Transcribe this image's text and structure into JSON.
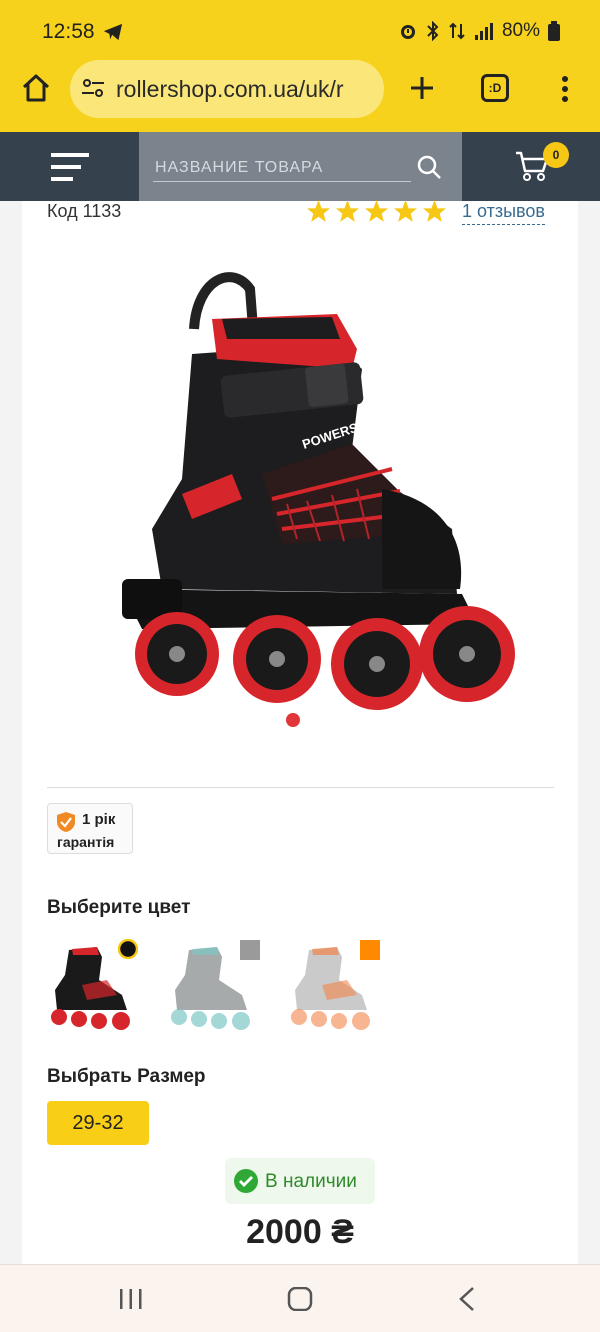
{
  "status_bar": {
    "time": "12:58",
    "battery": "80%"
  },
  "browser": {
    "url": "rollershop.com.ua/uk/r",
    "tabs_label": ":D"
  },
  "header": {
    "search_placeholder": "НАЗВАНИЕ ТОВАРА",
    "cart_count": "0"
  },
  "product": {
    "code": "Код 1133",
    "rating": 5,
    "reviews_label": "1 отзывов",
    "warranty_line1": "1 рік",
    "warranty_line2": "гарантія",
    "color_heading": "Выберите цвет",
    "colors": [
      {
        "name": "black-red",
        "dot": "#111111",
        "accent": "#d7262b",
        "selected": true
      },
      {
        "name": "grey-teal",
        "dot": "#9a9a9a",
        "accent": "#7cc7c4",
        "selected": false
      },
      {
        "name": "orange",
        "dot": "#ff8a00",
        "accent": "#f2834a",
        "selected": false
      }
    ],
    "size_heading": "Выбрать Размер",
    "size": "29-32",
    "stock": "В наличии",
    "price": "2000 ₴",
    "image_brand": "POWERSLIDE"
  },
  "colors": {
    "brand_yellow": "#f7d21c",
    "header_dark": "#35414d",
    "accent_red": "#e0363a",
    "stock_green": "#2f8a2a"
  }
}
